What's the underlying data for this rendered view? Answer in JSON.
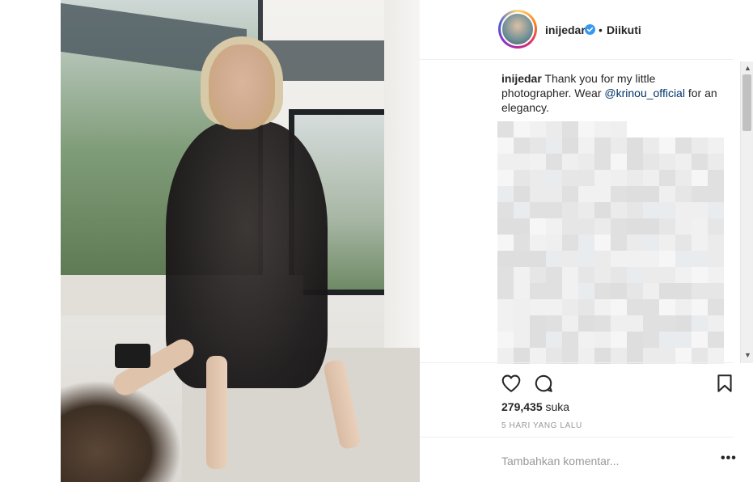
{
  "post": {
    "username": "inijedar",
    "verified_icon": "verified-badge-icon",
    "separator": "•",
    "follow_status": "Diikuti",
    "caption_user": "inijedar",
    "caption_text_1": " Thank you for my little photographer. Wear ",
    "caption_mention": "@krinou_official",
    "caption_text_2": " for an elegancy.",
    "likes_count": "279,435",
    "likes_suffix": "suka",
    "timestamp": "5 HARI YANG LALU",
    "comment_placeholder": "Tambahkan komentar...",
    "more_label": "•••"
  },
  "icons": {
    "like": "heart-icon",
    "comment": "comment-icon",
    "save": "bookmark-icon",
    "scroll_up": "▲",
    "scroll_down": "▼"
  },
  "colors": {
    "text": "#262626",
    "muted": "#999999",
    "mention": "#003569",
    "verified": "#3897f0"
  }
}
